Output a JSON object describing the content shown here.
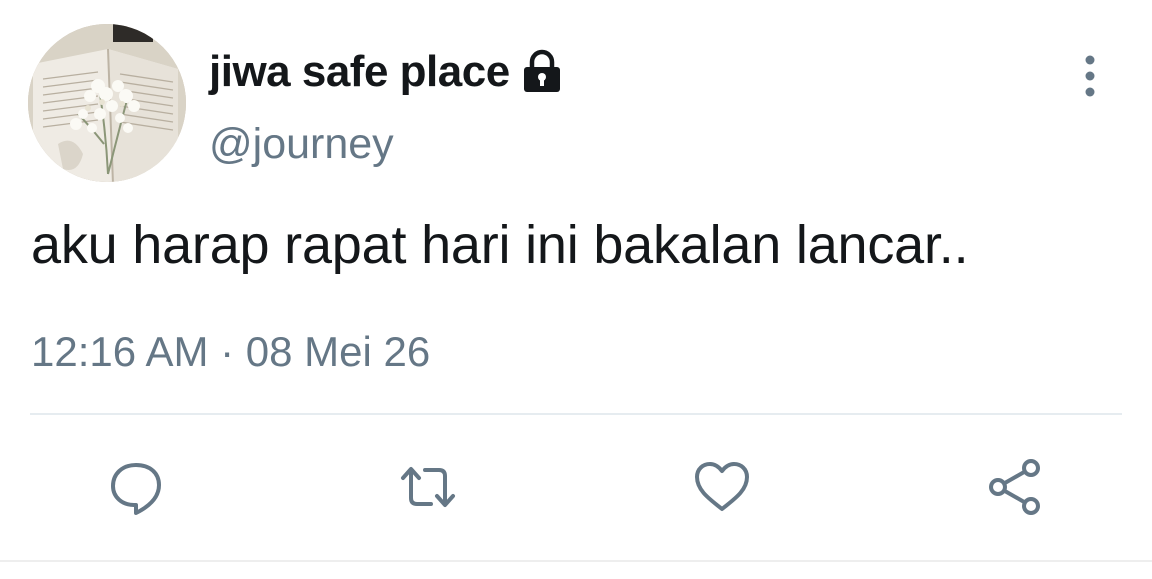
{
  "tweet": {
    "display_name": "jiwa safe place",
    "handle": "@journey",
    "text": "aku harap rapat hari ini bakalan lancar..",
    "timestamp": "12:16 AM · 08 Mei 26",
    "account_icon": "lock-icon"
  },
  "actions": {
    "reply_icon": "reply-icon",
    "retweet_icon": "retweet-icon",
    "like_icon": "heart-icon",
    "share_icon": "share-icon",
    "more_icon": "more-vertical-icon"
  },
  "colors": {
    "text_primary": "#14171a",
    "text_secondary": "#657786",
    "divider": "#e6ecf0"
  }
}
